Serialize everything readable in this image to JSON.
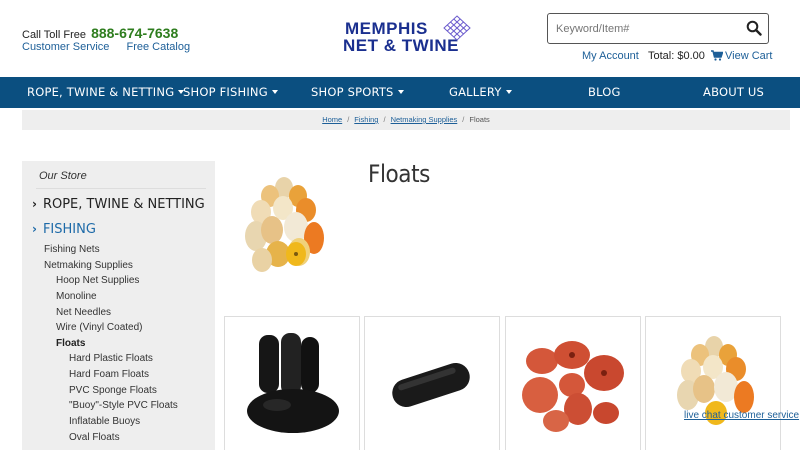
{
  "header": {
    "toll_label": "Call Toll Free",
    "phone": "888-674-7638",
    "customer_service": "Customer Service",
    "free_catalog": "Free Catalog",
    "logo_line1": "MEMPHIS",
    "logo_line2": "NET & TWINE",
    "search_placeholder": "Keyword/Item#",
    "my_account": "My Account",
    "total": "Total: $0.00",
    "view_cart": "View Cart"
  },
  "nav": {
    "items": [
      {
        "label": "Rope, Twine & Netting",
        "dropdown": true
      },
      {
        "label": "Shop Fishing",
        "dropdown": true
      },
      {
        "label": "Shop Sports",
        "dropdown": true
      },
      {
        "label": "Gallery",
        "dropdown": true
      },
      {
        "label": "Blog",
        "dropdown": false
      },
      {
        "label": "About Us",
        "dropdown": false
      }
    ]
  },
  "breadcrumb": {
    "items": [
      "Home",
      "Fishing",
      "Netmaking Supplies",
      "Floats"
    ]
  },
  "sidebar": {
    "title": "Our Store",
    "main": [
      {
        "label": "ROPE, TWINE & NETTING"
      },
      {
        "label": "FISHING"
      }
    ],
    "sub1": [
      "Fishing Nets",
      "Netmaking Supplies"
    ],
    "sub2": [
      "Hoop Net Supplies",
      "Monoline",
      "Net Needles",
      "Wire (Vinyl Coated)",
      "Floats"
    ],
    "sub3": [
      "Hard Plastic Floats",
      "Hard Foam Floats",
      "PVC Sponge Floats",
      "\"Buoy\"-Style PVC Floats",
      "Inflatable Buoys",
      "Oval Floats"
    ]
  },
  "page": {
    "title": "Floats"
  },
  "livechat": "live chat customer service",
  "colors": {
    "nav_bg": "#0b4f80",
    "link": "#1d5f98",
    "phone": "#2e7d1e",
    "logo": "#1a2f8f"
  }
}
